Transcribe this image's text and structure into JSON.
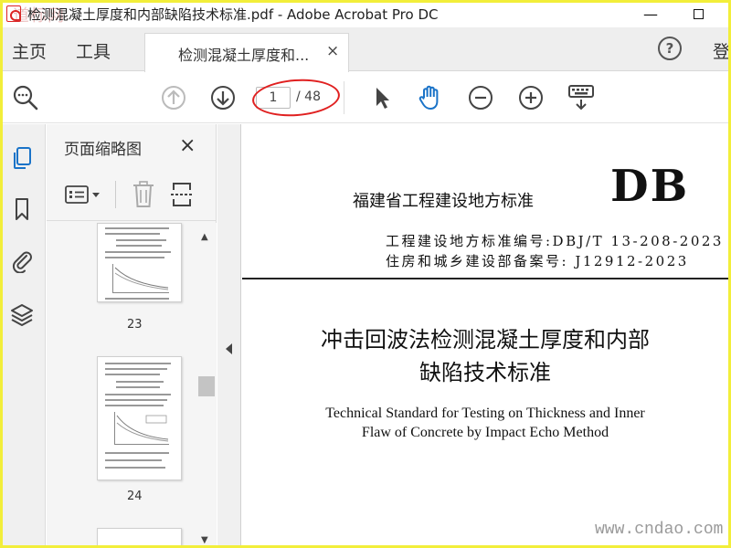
{
  "window": {
    "title": "检测混凝土厚度和内部缺陷技术标准.pdf - Adobe Acrobat Pro DC",
    "watermark": "道标网",
    "minimize_glyph": "—"
  },
  "tabbar": {
    "home_label": "主页",
    "tools_label": "工具",
    "doc_tab_label": "检测混凝土厚度和...",
    "doc_tab_close": "×",
    "help_glyph": "?",
    "login_label": "登"
  },
  "toolbar": {
    "current_page": "1",
    "total_pages": "/ 48",
    "annotation_color": "#e02020"
  },
  "thumbnails": {
    "title": "页面缩略图",
    "close_glyph": "×",
    "pages": [
      {
        "label": "23"
      },
      {
        "label": "24"
      }
    ]
  },
  "document": {
    "std_title": "福建省工程建设地方标准",
    "db_mark": "DB",
    "code_line": "工程建设地方标准编号:DBJ/T 13-208-2023",
    "record_line": "住房和城乡建设部备案号: J12912-2023",
    "title_cn_line1": "冲击回波法检测混凝土厚度和内部",
    "title_cn_line2": "缺陷技术标准",
    "title_en_line1": "Technical Standard for Testing on Thickness and Inner",
    "title_en_line2": "Flaw of Concrete by Impact Echo Method",
    "watermark": "www.cndao.com"
  },
  "colors": {
    "frame": "#f2ee3a",
    "hand_tool_active": "#1a73c8",
    "rail_active": "#1a73c8"
  }
}
